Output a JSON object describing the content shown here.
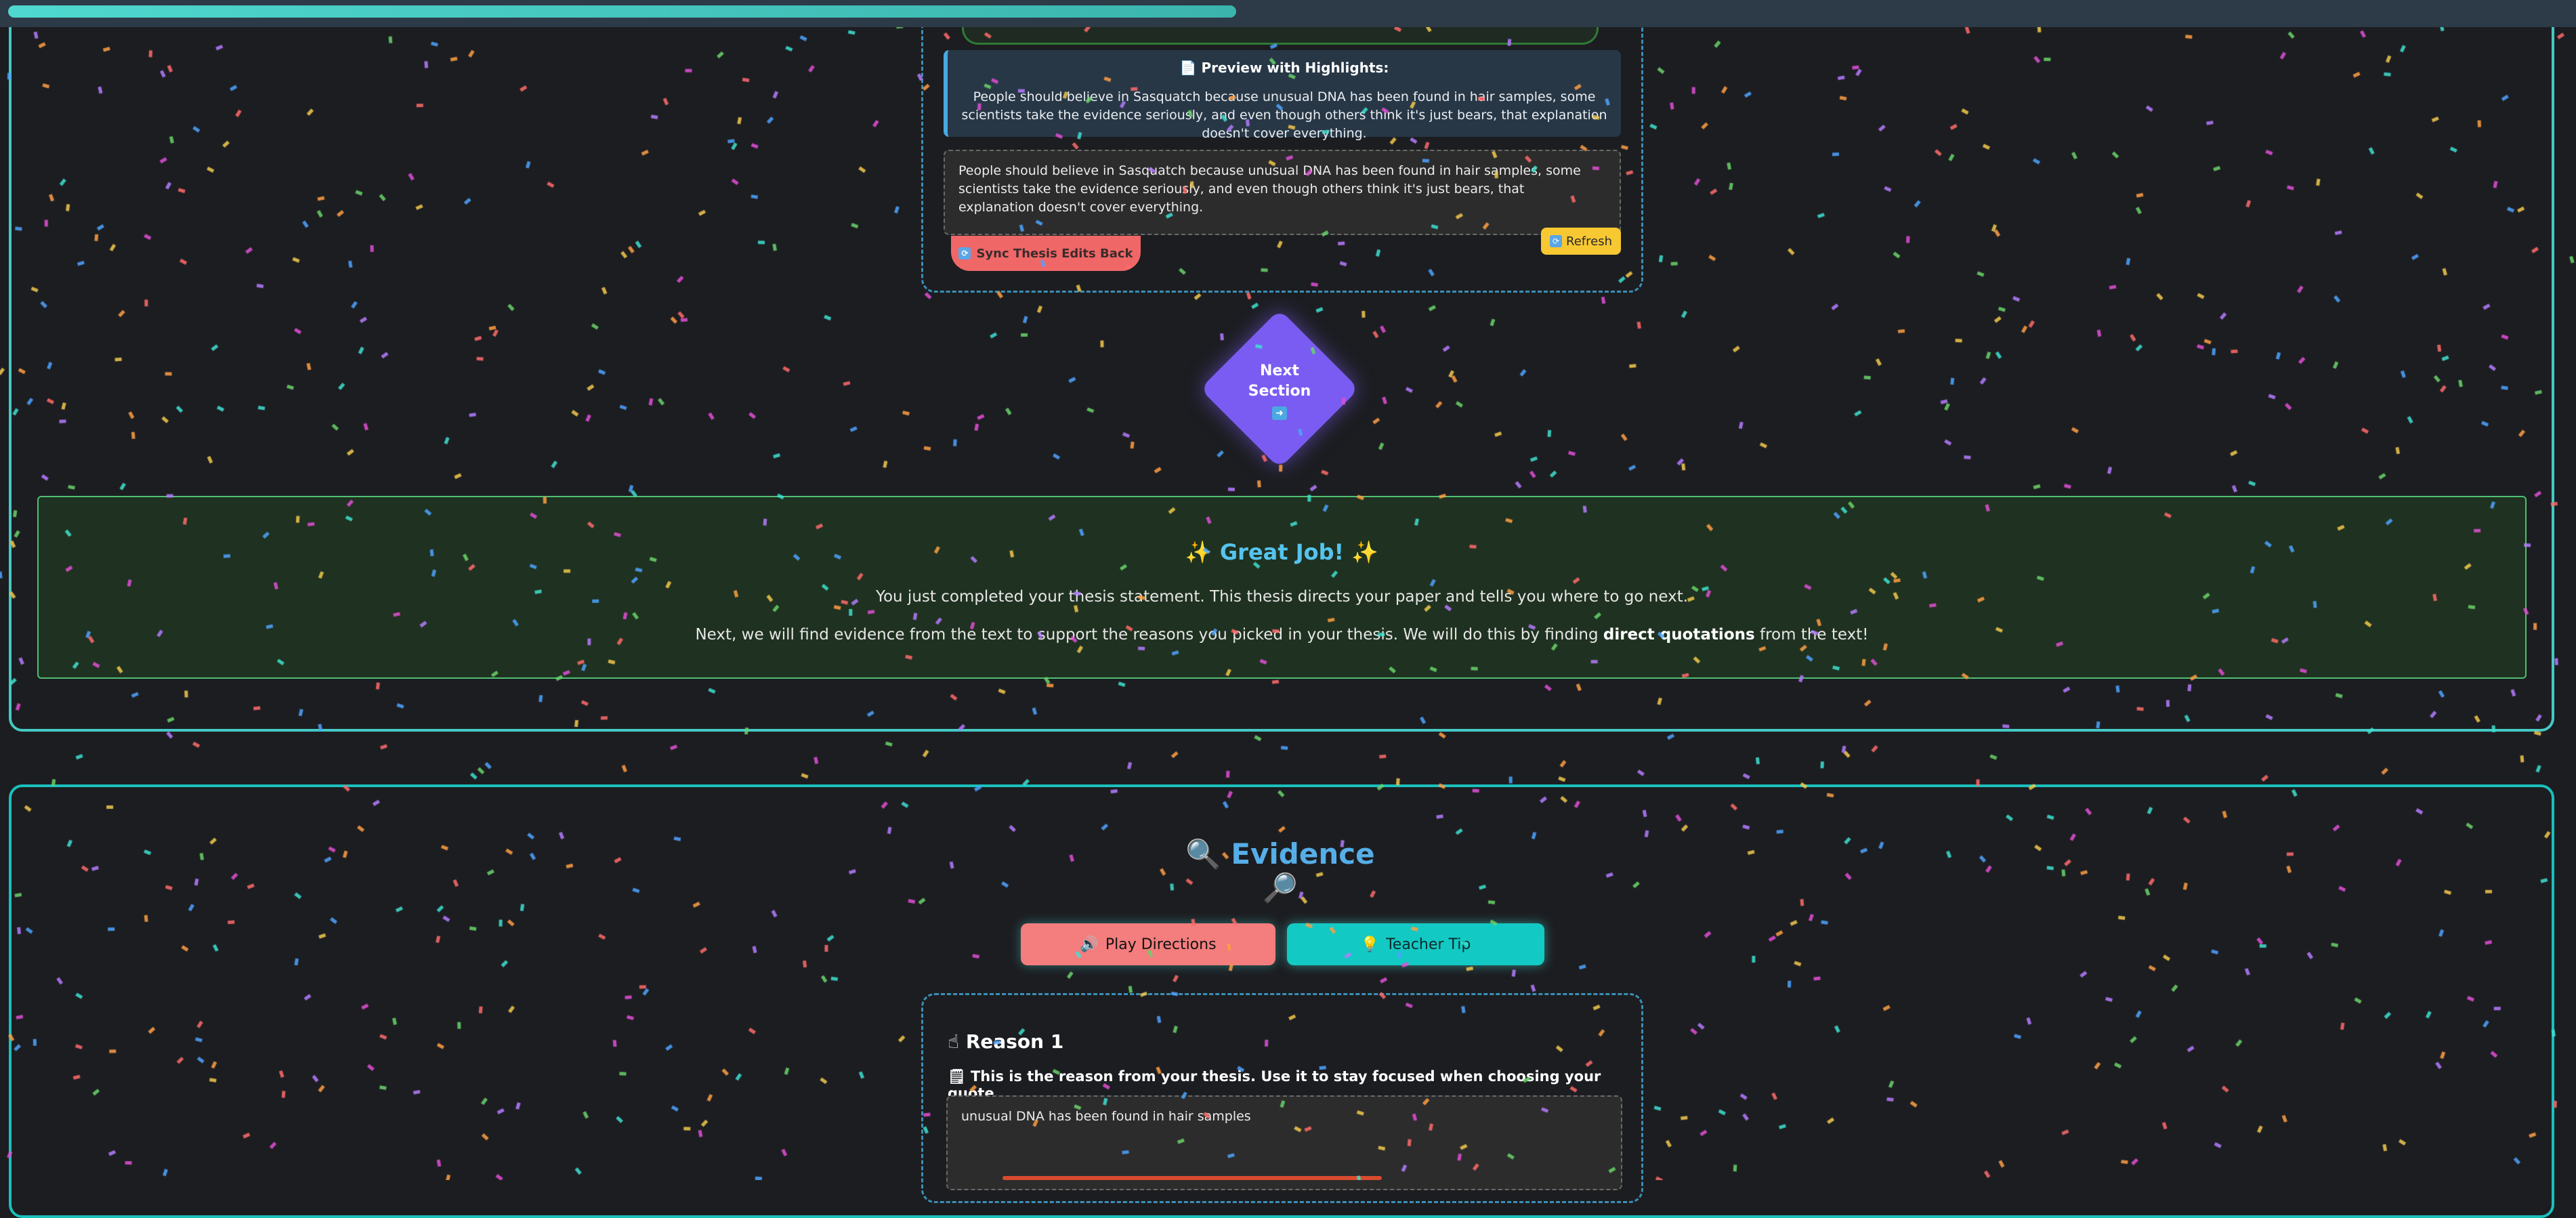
{
  "progress": {
    "fraction": 0.48
  },
  "preview": {
    "title": "Preview with Highlights:",
    "text": "People should believe in Sasquatch because unusual DNA has been found in hair samples, some scientists take the evidence seriously, and even though others think it's just bears, that explanation doesn't cover everything."
  },
  "thesis_edit": {
    "text": "People should believe in Sasquatch because unusual DNA has been found in hair samples, some scientists take the evidence seriously, and even though others think it's just bears, that explanation doesn't cover everything."
  },
  "buttons": {
    "sync": "Sync Thesis Edits Back",
    "refresh": "Refresh",
    "next_line1": "Next",
    "next_line2": "Section",
    "play": "Play Directions",
    "tip": "Teacher Tip"
  },
  "great_job": {
    "title": "✨ Great Job! ✨",
    "line1": "You just completed your thesis statement. This thesis directs your paper and tells you where to go next.",
    "line2_pre": "Next, we will find evidence from the text to support the reasons you picked in your thesis. We will do this by finding ",
    "line2_bold": "direct quotations",
    "line2_post": " from the text!"
  },
  "evidence": {
    "title": "Evidence",
    "reason_title": "Reason 1",
    "reason_sub": "This is the reason from your thesis. Use it to stay focused when choosing your quote.",
    "reason_value": "unusual DNA has been found in hair samples"
  },
  "icons": {
    "preview": "document-icon",
    "sync": "sync-icon",
    "refresh": "refresh-icon",
    "next": "arrow-right-icon",
    "evidence_left": "magnifier-icon",
    "evidence_right": "magnifier-icon",
    "play": "speaker-icon",
    "tip": "lightbulb-icon",
    "reason": "pointing-hand-icon",
    "reason_sub": "notepad-icon"
  },
  "colors": {
    "background": "#1c1d21",
    "section_border": "#45c9c4",
    "accent_purple": "#7a5cf2",
    "great_job_bg": "#1f3120",
    "evidence_title": "#55aee8",
    "play_button": "#f47d7d",
    "tip_button": "#13c9c4",
    "refresh_button": "#f7c832",
    "sync_button": "#f06767"
  }
}
